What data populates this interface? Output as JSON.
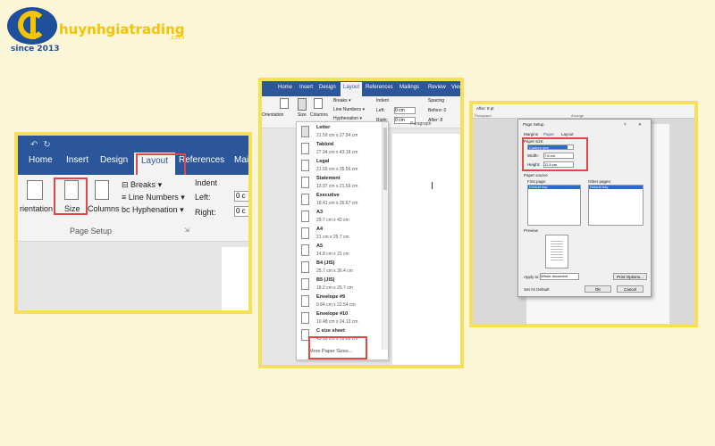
{
  "brand": {
    "name": "huynhgiatrading",
    "suffix": ".com",
    "since": "since 2013",
    "primary_color": "#1f4e9a",
    "accent_color": "#f5c400",
    "frame_color": "#f6e05a",
    "highlight_color": "#e04848"
  },
  "panel1": {
    "qat_icons": [
      "undo-icon",
      "redo-icon"
    ],
    "tabs": [
      "Home",
      "Insert",
      "Design",
      "Layout",
      "References",
      "Maili"
    ],
    "active_tab": "Layout",
    "buttons": {
      "orientation": "rientation",
      "size": "Size",
      "columns": "Columns"
    },
    "breaks": "Breaks",
    "line_numbers": "Line Numbers",
    "hyphenation": "Hyphenation",
    "indent": {
      "title": "Indent",
      "left": "Left:",
      "left_val": "0 c",
      "right": "Right:",
      "right_val": "0 c"
    },
    "group": "Page Setup"
  },
  "panel2": {
    "tabs": [
      "Home",
      "Insert",
      "Design",
      "Layout",
      "References",
      "Mailings",
      "Review",
      "View"
    ],
    "active_tab": "Layout",
    "ribbon": {
      "orientation": "Orientation",
      "size": "Size",
      "columns": "Columns",
      "breaks": "Breaks",
      "line_numbers": "Line Numbers",
      "hyphenation": "Hyphenation",
      "indent": "Indent",
      "left": "Left:",
      "left_val": "0 cm",
      "right": "Right:",
      "right_val": "0 cm",
      "spacing": "Spacing",
      "before": "Before:",
      "before_val": "0",
      "after": "After:",
      "after_val": "8",
      "paragraph": "Paragraph"
    },
    "paper_sizes": [
      {
        "name": "Letter",
        "dims": "21.59 cm x 27.94 cm"
      },
      {
        "name": "Tabloid",
        "dims": "27.94 cm x 43.18 cm"
      },
      {
        "name": "Legal",
        "dims": "21.59 cm x 35.56 cm"
      },
      {
        "name": "Statement",
        "dims": "13.97 cm x 21.59 cm"
      },
      {
        "name": "Executive",
        "dims": "18.41 cm x 26.67 cm"
      },
      {
        "name": "A3",
        "dims": "29.7 cm x 42 cm"
      },
      {
        "name": "A4",
        "dims": "21 cm x 29.7 cm"
      },
      {
        "name": "A5",
        "dims": "14.8 cm x 21 cm"
      },
      {
        "name": "B4 (JIS)",
        "dims": "25.7 cm x 36.4 cm"
      },
      {
        "name": "B5 (JIS)",
        "dims": "18.2 cm x 25.7 cm"
      },
      {
        "name": "Envelope #9",
        "dims": "9.84 cm x 22.54 cm"
      },
      {
        "name": "Envelope #10",
        "dims": "10.48 cm x 24.13 cm"
      },
      {
        "name": "C size sheet",
        "dims": "43.18 cm x 55.88 cm"
      }
    ],
    "more_paper_sizes": "More Paper Sizes..."
  },
  "panel3": {
    "top": {
      "after": "After:",
      "after_val": "8 pt",
      "paragraph": "Paragraph",
      "arrange": "Arrange"
    },
    "dialog": {
      "title": "Page Setup",
      "tabs": [
        "Margins",
        "Paper",
        "Layout"
      ],
      "paper_size_label": "Paper size:",
      "paper_size_value": "Custom size",
      "width_label": "Width:",
      "width_value": "7.6 cm",
      "height_label": "Height:",
      "height_value": "12.5 cm",
      "paper_source_label": "Paper source",
      "first_page_label": "First page:",
      "first_page_item": "Default tray",
      "other_pages_label": "Other pages:",
      "other_pages_item": "Default tray",
      "preview_label": "Preview",
      "apply_label": "Apply to:",
      "apply_value": "Whole document",
      "print_options": "Print Options...",
      "set_default": "Set As Default",
      "ok": "OK",
      "cancel": "Cancel"
    }
  }
}
